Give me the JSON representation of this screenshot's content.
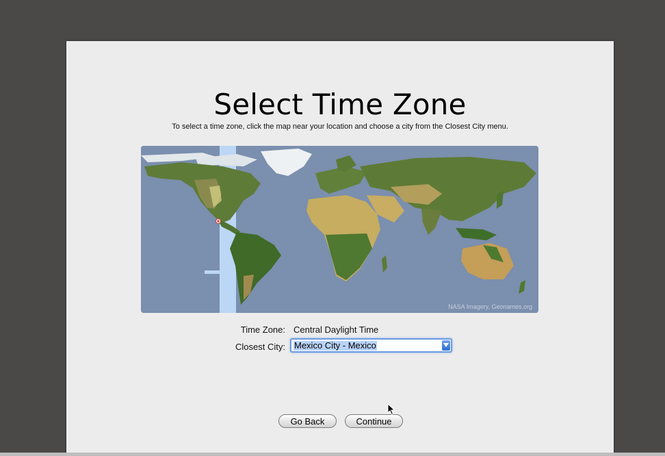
{
  "page": {
    "title": "Select Time Zone",
    "instructions": "To select a time zone, click the map near your location and choose a city from the Closest City menu."
  },
  "map": {
    "credit": "NASA Imagery, Geonames.org",
    "selected_marker_icon": "location-dot-icon",
    "colors": {
      "ocean": "#7b8fae",
      "land": "#5e7a36",
      "desert": "#bfa65a",
      "ice": "#e8ecef",
      "highlight_band": "#bcd6f6"
    }
  },
  "fields": {
    "time_zone_label": "Time Zone:",
    "time_zone_value": "Central Daylight Time",
    "closest_city_label": "Closest City:",
    "closest_city_value": "Mexico City - Mexico"
  },
  "buttons": {
    "back_label": "Go Back",
    "continue_label": "Continue"
  }
}
